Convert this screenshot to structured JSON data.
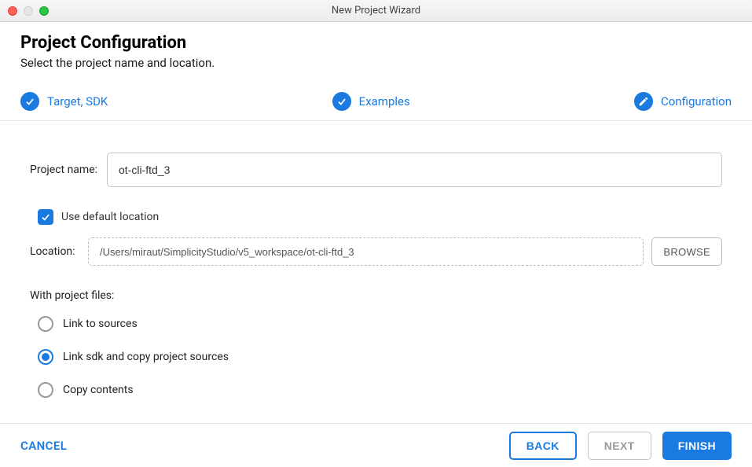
{
  "window": {
    "title": "New Project Wizard"
  },
  "header": {
    "title": "Project Configuration",
    "subtitle": "Select the project name and location."
  },
  "steps": {
    "target": "Target, SDK",
    "examples": "Examples",
    "configuration": "Configuration"
  },
  "form": {
    "project_name_label": "Project name:",
    "project_name_value": "ot-cli-ftd_3",
    "default_location_label": "Use default location",
    "default_location_checked": true,
    "location_label": "Location:",
    "location_value": "/Users/miraut/SimplicityStudio/v5_workspace/ot-cli-ftd_3",
    "browse_label": "BROWSE",
    "project_files_label": "With project files:",
    "radio_options": {
      "link_sources": "Link to sources",
      "link_sdk_copy": "Link sdk and copy project sources",
      "copy_contents": "Copy contents"
    },
    "radio_selected": "link_sdk_copy"
  },
  "footer": {
    "cancel": "CANCEL",
    "back": "BACK",
    "next": "NEXT",
    "finish": "FINISH"
  }
}
